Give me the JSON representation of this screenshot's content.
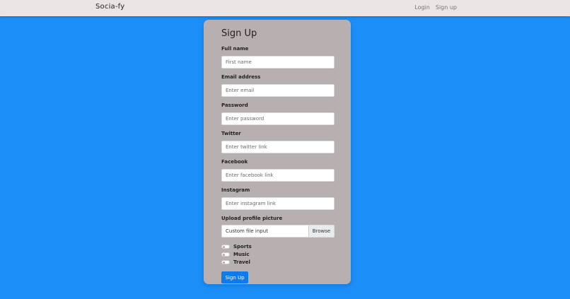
{
  "navbar": {
    "brand": "Socia-fy",
    "links": [
      "Login",
      "Sign up"
    ]
  },
  "form": {
    "title": "Sign Up",
    "fields": [
      {
        "label": "Full name",
        "placeholder": "First name"
      },
      {
        "label": "Email address",
        "placeholder": "Enter email"
      },
      {
        "label": "Password",
        "placeholder": "Enter password"
      },
      {
        "label": "Twitter",
        "placeholder": "Enter twitter link"
      },
      {
        "label": "Facebook",
        "placeholder": "Enter facebook link"
      },
      {
        "label": "Instagram",
        "placeholder": "Enter instagram link"
      }
    ],
    "upload": {
      "label": "Upload profile picture",
      "text": "Custom file input",
      "button": "Browse"
    },
    "toggles": [
      "Sports",
      "Music",
      "Travel"
    ],
    "submit": "Sign Up"
  },
  "colors": {
    "background": "#1b8ef8",
    "navbar": "#ebe4e4",
    "card": "#b8b0b0",
    "button": "#0d7bf0"
  }
}
